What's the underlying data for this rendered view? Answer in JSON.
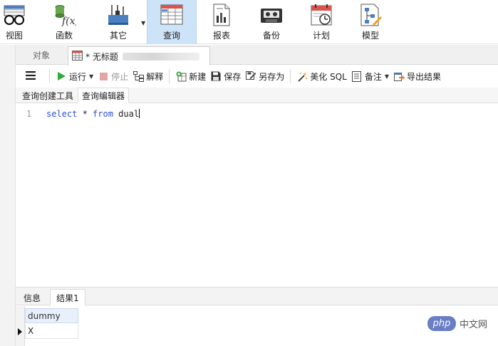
{
  "ribbon": {
    "items": [
      {
        "label": "视图",
        "icon": "glasses-icon"
      },
      {
        "label": "函数",
        "icon": "function-icon"
      },
      {
        "label": "其它",
        "icon": "tools-icon"
      },
      {
        "label": "查询",
        "icon": "query-table-icon"
      },
      {
        "label": "报表",
        "icon": "report-icon"
      },
      {
        "label": "备份",
        "icon": "backup-tape-icon"
      },
      {
        "label": "计划",
        "icon": "schedule-calendar-icon"
      },
      {
        "label": "模型",
        "icon": "model-diagram-icon"
      }
    ],
    "active": "查询"
  },
  "tabs": {
    "objects": "对象",
    "query": "* 无标题"
  },
  "toolbar": {
    "run": "运行",
    "stop": "停止",
    "explain": "解释",
    "new": "新建",
    "save": "保存",
    "save_as": "另存为",
    "beautify": "美化 SQL",
    "comment": "备注",
    "export": "导出结果"
  },
  "subtabs": {
    "builder": "查询创建工具",
    "editor": "查询编辑器"
  },
  "editor": {
    "line_number": "1",
    "kw_select": "select",
    "star": " * ",
    "kw_from": "from",
    "table": " dual"
  },
  "results": {
    "tabs": [
      "信息",
      "结果1"
    ],
    "active_tab": "结果1",
    "column": "dummy",
    "rows": [
      "X"
    ]
  },
  "watermark": {
    "badge": "php",
    "text": "中文网"
  },
  "colors": {
    "active_ribbon": "#cde3f7",
    "keyword": "#2a4fd6",
    "grid_header": "#e8f1fb"
  }
}
